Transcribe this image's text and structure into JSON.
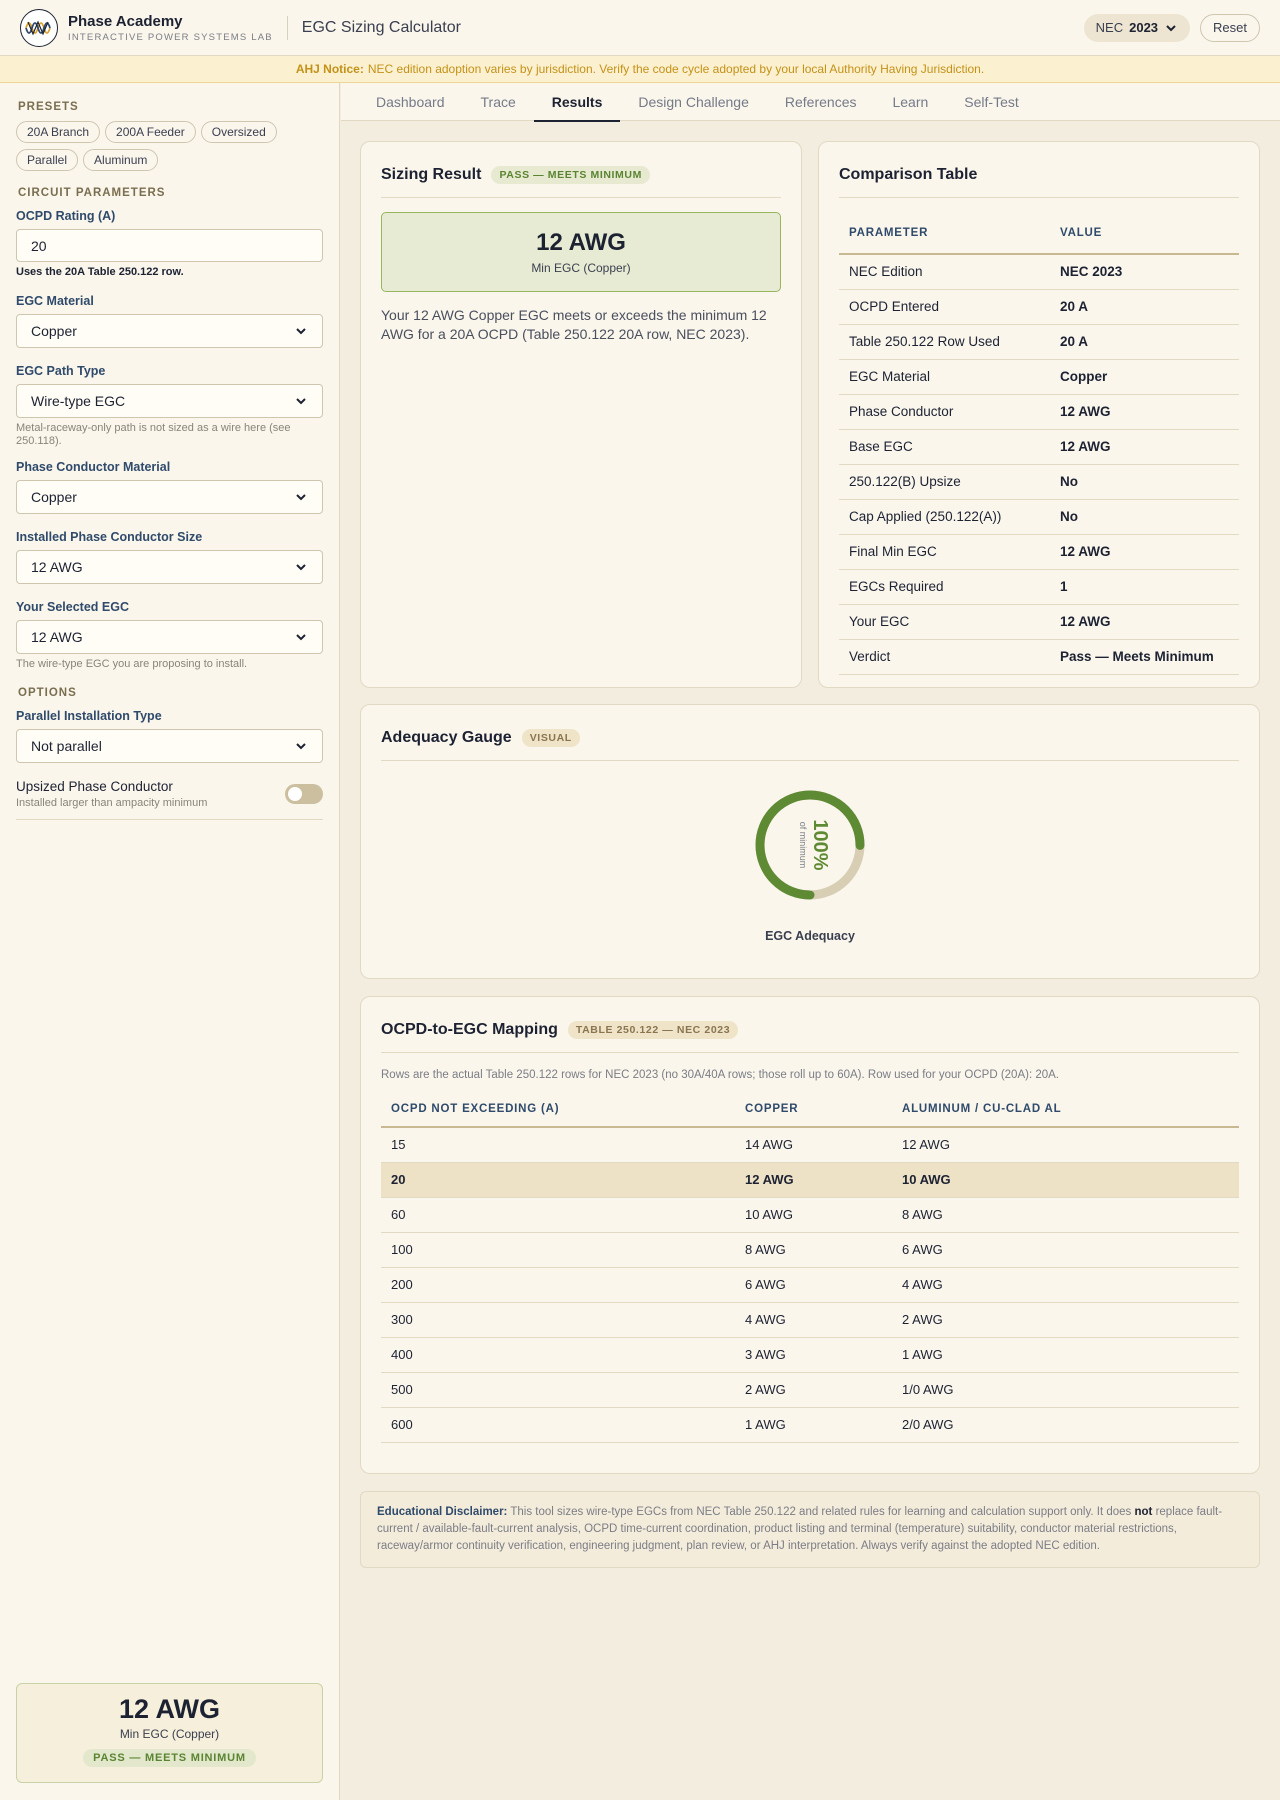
{
  "header": {
    "brand_name": "Phase Academy",
    "brand_sub": "INTERACTIVE POWER SYSTEMS LAB",
    "app_title": "EGC Sizing Calculator",
    "nec_label": "NEC",
    "nec_value": "2023",
    "reset_label": "Reset"
  },
  "notice": {
    "label": "AHJ Notice:",
    "text": "NEC edition adoption varies by jurisdiction. Verify the code cycle adopted by your local Authority Having Jurisdiction."
  },
  "sidebar": {
    "presets_title": "PRESETS",
    "presets": [
      "20A Branch",
      "200A Feeder",
      "Oversized",
      "Parallel",
      "Aluminum"
    ],
    "circuit_title": "CIRCUIT PARAMETERS",
    "ocpd_label": "OCPD Rating (A)",
    "ocpd_value": "20",
    "ocpd_hint": "Uses the 20A Table 250.122 row.",
    "egc_material_label": "EGC Material",
    "egc_material_value": "Copper",
    "egc_path_label": "EGC Path Type",
    "egc_path_value": "Wire-type EGC",
    "egc_path_hint": "Metal-raceway-only path is not sized as a wire here (see 250.118).",
    "phase_material_label": "Phase Conductor Material",
    "phase_material_value": "Copper",
    "phase_size_label": "Installed Phase Conductor Size",
    "phase_size_value": "12 AWG",
    "selected_egc_label": "Your Selected EGC",
    "selected_egc_value": "12 AWG",
    "selected_egc_hint": "The wire-type EGC you are proposing to install.",
    "options_title": "OPTIONS",
    "parallel_label": "Parallel Installation Type",
    "parallel_value": "Not parallel",
    "upsized_label": "Upsized Phase Conductor",
    "upsized_hint": "Installed larger than ampacity minimum",
    "summary_big": "12 AWG",
    "summary_sub": "Min EGC (Copper)",
    "summary_badge": "PASS — MEETS MINIMUM"
  },
  "tabs": [
    "Dashboard",
    "Trace",
    "Results",
    "Design Challenge",
    "References",
    "Learn",
    "Self-Test"
  ],
  "active_tab": "Results",
  "sizing": {
    "title": "Sizing Result",
    "badge": "PASS — MEETS MINIMUM",
    "big": "12 AWG",
    "sub": "Min EGC (Copper)",
    "text": "Your 12 AWG Copper EGC meets or exceeds the minimum 12 AWG for a 20A OCPD (Table 250.122 20A row, NEC 2023)."
  },
  "comparison": {
    "title": "Comparison Table",
    "headers": [
      "PARAMETER",
      "VALUE"
    ],
    "rows": [
      [
        "NEC Edition",
        "NEC 2023"
      ],
      [
        "OCPD Entered",
        "20 A"
      ],
      [
        "Table 250.122 Row Used",
        "20 A"
      ],
      [
        "EGC Material",
        "Copper"
      ],
      [
        "Phase Conductor",
        "12 AWG"
      ],
      [
        "Base EGC",
        "12 AWG"
      ],
      [
        "250.122(B) Upsize",
        "No"
      ],
      [
        "Cap Applied (250.122(A))",
        "No"
      ],
      [
        "Final Min EGC",
        "12 AWG"
      ],
      [
        "EGCs Required",
        "1"
      ],
      [
        "Your EGC",
        "12 AWG"
      ],
      [
        "Verdict",
        "Pass — Meets Minimum"
      ]
    ]
  },
  "gauge": {
    "title": "Adequacy Gauge",
    "badge": "VISUAL",
    "percent": 100,
    "value_text": "100%",
    "value_sub": "of minimum",
    "label": "EGC Adequacy",
    "color": "#5f8a34",
    "track_color": "#d8ceb4"
  },
  "mapping": {
    "title": "OCPD-to-EGC Mapping",
    "badge": "TABLE 250.122 — NEC 2023",
    "note": "Rows are the actual Table 250.122 rows for NEC 2023 (no 30A/40A rows; those roll up to 60A). Row used for your OCPD (20A): 20A.",
    "headers": [
      "OCPD NOT EXCEEDING (A)",
      "COPPER",
      "ALUMINUM / CU-CLAD AL"
    ],
    "highlight_index": 1,
    "rows": [
      [
        "15",
        "14 AWG",
        "12 AWG"
      ],
      [
        "20",
        "12 AWG",
        "10 AWG"
      ],
      [
        "60",
        "10 AWG",
        "8 AWG"
      ],
      [
        "100",
        "8 AWG",
        "6 AWG"
      ],
      [
        "200",
        "6 AWG",
        "4 AWG"
      ],
      [
        "300",
        "4 AWG",
        "2 AWG"
      ],
      [
        "400",
        "3 AWG",
        "1 AWG"
      ],
      [
        "500",
        "2 AWG",
        "1/0 AWG"
      ],
      [
        "600",
        "1 AWG",
        "2/0 AWG"
      ]
    ]
  },
  "disclaimer": {
    "label": "Educational Disclaimer:",
    "text_before": "This tool sizes wire-type EGCs from NEC Table 250.122 and related rules for learning and calculation support only. It does",
    "emphasis": "not",
    "text_after": "replace fault-current / available-fault-current analysis, OCPD time-current coordination, product listing and terminal (temperature) suitability, conductor material restrictions, raceway/armor continuity verification, engineering judgment, plan review, or AHJ interpretation. Always verify against the adopted NEC edition."
  }
}
